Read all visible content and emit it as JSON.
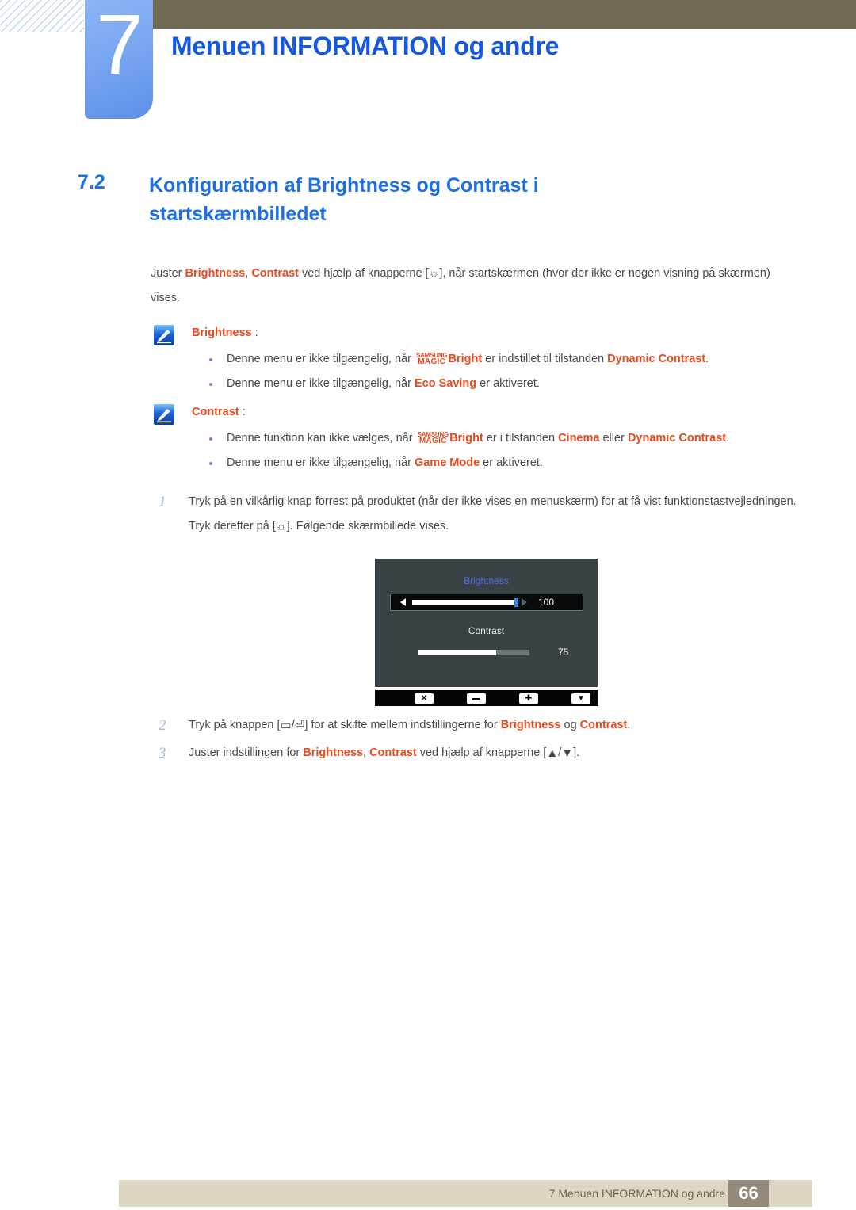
{
  "header": {
    "chapter_number": "7",
    "chapter_title": "Menuen INFORMATION og andre"
  },
  "section": {
    "number": "7.2",
    "title": "Konfiguration af Brightness og Contrast i startskærmbilledet"
  },
  "intro": {
    "p1_a": "Juster ",
    "kw1": "Brightness",
    "p1_b": ", ",
    "kw2": "Contrast",
    "p1_c": " ved hjælp af knapperne [",
    "sun_icon": "☼",
    "p1_d": "], når startskærmen (hvor der ikke er nogen visning på skærmen) vises."
  },
  "notes": [
    {
      "icon": "note-pen-icon",
      "heading": "Brightness",
      "colon": ":",
      "bullets": [
        {
          "a": "Denne menu er ikke tilgængelig, når ",
          "logo_top": "SAMSUNG",
          "logo_bottom": "MAGIC",
          "logo_suffix": "Bright",
          "b": " er indstillet til tilstanden ",
          "kw": "Dynamic Contrast",
          "c": "."
        },
        {
          "a": "Denne menu er ikke tilgængelig, når ",
          "kw": "Eco Saving",
          "c": " er aktiveret."
        }
      ]
    },
    {
      "icon": "note-pen-icon",
      "heading": "Contrast",
      "colon": ":",
      "bullets": [
        {
          "a": "Denne funktion kan ikke vælges, når ",
          "logo_top": "SAMSUNG",
          "logo_bottom": "MAGIC",
          "logo_suffix": "Bright",
          "b": " er i tilstanden ",
          "kw": "Cinema",
          "b2": " eller ",
          "kw2": "Dynamic Contrast",
          "c": "."
        },
        {
          "a": "Denne menu er ikke tilgængelig, når ",
          "kw": "Game Mode",
          "c": " er aktiveret."
        }
      ]
    }
  ],
  "steps": [
    {
      "num": "1",
      "a": "Tryk på en vilkårlig knap forrest på produktet (når der ikke vises en menuskærm) for at få vist funktionstastvejledningen. Tryk derefter på [",
      "icon": "☼",
      "b": "]. Følgende skærmbillede vises."
    },
    {
      "num": "2",
      "a": "Tryk på knappen [",
      "icon1": "▭",
      "slash": "/",
      "icon2": "⏎",
      "b": "] for at skifte mellem indstillingerne for ",
      "kw": "Brightness",
      "c": " og ",
      "kw2": "Contrast",
      "d": "."
    },
    {
      "num": "3",
      "a": "Juster indstillingen for ",
      "kw": "Brightness",
      "b": ", ",
      "kw2": "Contrast",
      "c": " ved hjælp af knapperne [",
      "icon1": "▲",
      "slash": "/",
      "icon2": "▼",
      "d": "]."
    }
  ],
  "osd": {
    "brightness_label": "Brightness",
    "brightness_value": "100",
    "contrast_label": "Contrast",
    "contrast_value": "75",
    "keys": [
      "✕",
      "▬",
      "✚",
      "▼"
    ]
  },
  "footer": {
    "text": "7 Menuen INFORMATION og andre",
    "page": "66"
  },
  "colors": {
    "accent_blue": "#1558e0",
    "keyword_orange": "#e8491d",
    "header_olive": "#706b55",
    "footer_beige": "#dcd6c2",
    "page_box": "#95897c",
    "osd_bg": "#3b4245"
  }
}
